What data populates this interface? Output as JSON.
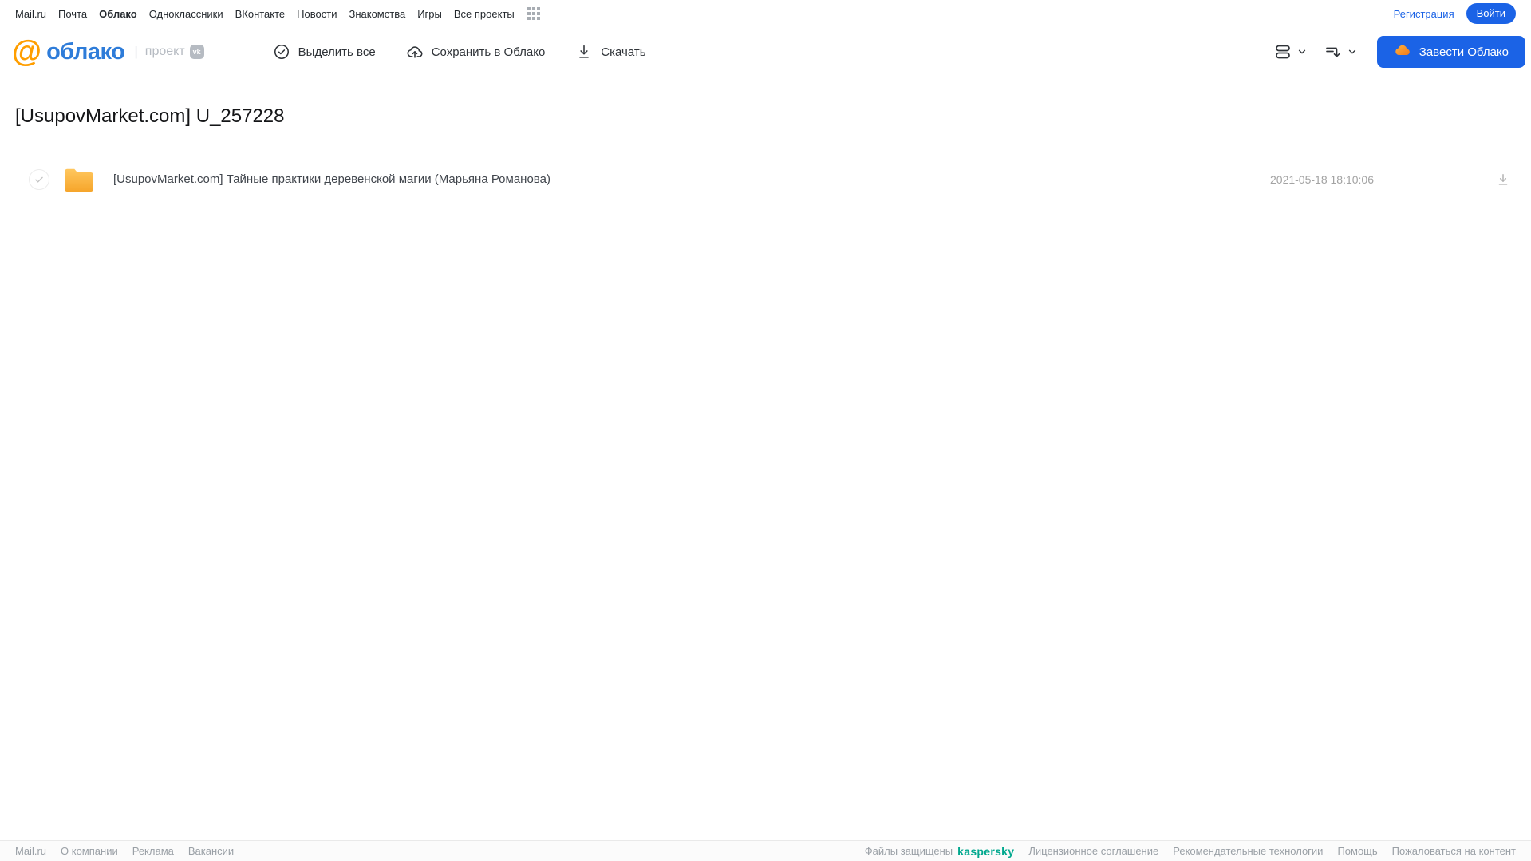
{
  "topnav": {
    "items": [
      "Mail.ru",
      "Почта",
      "Облако",
      "Одноклассники",
      "ВКонтакте",
      "Новости",
      "Знакомства",
      "Игры",
      "Все проекты"
    ],
    "registration_label": "Регистрация",
    "login_label": "Войти"
  },
  "header": {
    "logo_at": "@",
    "logo_text": "облако",
    "logo_divider": "|",
    "project_label": "проект",
    "vk_badge_label": "vk",
    "toolbar": {
      "select_all": "Выделить все",
      "save_to_cloud": "Сохранить в Облако",
      "download": "Скачать"
    },
    "create_cloud_label": "Завести Облако"
  },
  "main": {
    "title": "[UsupovMarket.com] U_257228",
    "files": [
      {
        "type": "folder",
        "name": "[UsupovMarket.com] Тайные практики деревенской магии (Марьяна Романова)",
        "date": "2021-05-18 18:10:06"
      }
    ]
  },
  "footer": {
    "left_links": [
      "Mail.ru",
      "О компании",
      "Реклама",
      "Вакансии"
    ],
    "protected_text": "Файлы защищены",
    "kaspersky_label": "kaspersky",
    "right_links": [
      "Лицензионное соглашение",
      "Рекомендательные технологии",
      "Помощь",
      "Пожаловаться на контент"
    ]
  },
  "colors": {
    "accent_blue": "#1b63e6",
    "logo_blue": "#2e7cd9",
    "logo_orange": "#ff9e00",
    "folder_amber": "#f6a52b",
    "kaspersky_green": "#00a88e"
  }
}
